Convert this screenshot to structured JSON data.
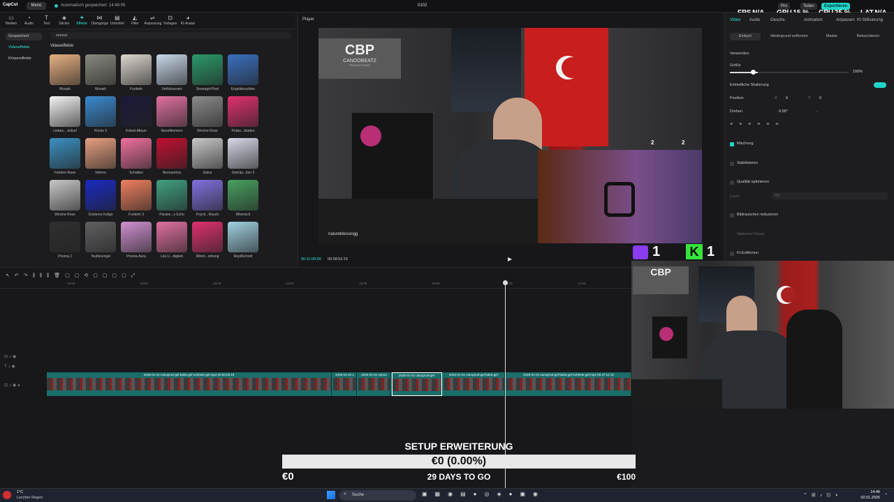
{
  "app": {
    "name": "CapCut",
    "menu": "Menü",
    "autosave": "Automatisch gespeichert: 14:46:05",
    "project": "0102"
  },
  "stats": {
    "fps_label": "FPS",
    "fps": "N/A",
    "gpu_label": "GPU",
    "gpu": "15 %",
    "cpu_label": "CPU",
    "cpu": "25 %",
    "lat_label": "LAT",
    "lat": "N/A"
  },
  "header_buttons": {
    "pro": "Pro",
    "share": "Teilen",
    "export": "Exportieren"
  },
  "toolbar": [
    "Medien",
    "Audio",
    "Text",
    "Sticker",
    "Effekte",
    "Übergänge",
    "Untertitel",
    "Filter",
    "Anpassung",
    "Vorlagen",
    "KI-Avatar"
  ],
  "categories": [
    "Gespeichert",
    "Videoeffekte",
    "Körpereffekte"
  ],
  "search_value": "zensur",
  "section_title": "Videoeffekte",
  "effects": [
    "Mosaik",
    "Mosaik",
    "Funkeln",
    "Umfokussiert",
    "Smaragd-Pixel",
    "Engelsleuchten",
    "Liebes-...kritzel",
    "Kricke 3",
    "Kritzel-Album",
    "Neonflimmern",
    "Weiche Rose",
    "Pulsie...tbatten",
    "Farbton-Rave",
    "Inferno",
    "Schatten",
    "Neonumriss",
    "Glanz",
    "Gekräu...lien 3",
    "Weiche Rose",
    "Düsteres Indigo",
    "Funkeln 3",
    "Parano...s Echo",
    "Psych...Rauch",
    "Ätherisch",
    "Prisma 2",
    "Teufelsengel",
    "Prisma-Aura",
    "Lila Li...digkeit",
    "Ätheri...rehung",
    "RepliSchnitt"
  ],
  "player": {
    "label": "Player",
    "time_current": "00:11:00:00",
    "time_total": "00:58:52:15"
  },
  "video": {
    "logo_main": "CBP",
    "logo_sub": "CANOOBEATZ",
    "logo_sub2": "PRODUCTIONS",
    "overlay_left": "natureblessingg",
    "score_a": "2",
    "score_b": "2"
  },
  "score": {
    "twitch": "1",
    "kick": "1"
  },
  "inspector": {
    "tabs": [
      "Video",
      "Audio",
      "Gesche.",
      "Animation",
      "Anpassen",
      "KI-Stilisierung"
    ],
    "subtabs": [
      "Einfach",
      "Hintergrund entfernen",
      "Maske",
      "Retuschieren"
    ],
    "verwenden": "Verwenden",
    "groesse": "Größe",
    "groesse_val": "100%",
    "skalierung": "Einheitliche Skalierung",
    "position": "Position",
    "pos_x_label": "X",
    "pos_x": "0",
    "pos_y_label": "Y",
    "pos_y": "0",
    "drehen": "Drehen",
    "drehen_val": "0.00°",
    "drehen_dash": "-",
    "mischung": "Mischung",
    "stabil": "Stabilisieren",
    "qualitaet": "Qualität optimieren",
    "qualitaet_mode": "HD",
    "qualitaet_level": "Level",
    "rauschen": "Bildrauschen reduzieren",
    "rauschen_sub": "Optische Flüsse",
    "ki": "KI-Entfernen"
  },
  "timeline": {
    "ticks": [
      "10:04",
      "10:05",
      "10:03",
      "10:04",
      "10:05",
      "10:06",
      "11:00",
      "11:02"
    ],
    "clips": [
      "2026-01-01-canoprod-gel-baba-gel-sohbete-gel.mp4  00:00:05:18",
      "2026-01-01-c",
      "2026-01-01-canoo",
      "2026-01-01-canoprod-gel-",
      "2026-01-01-canoprod-gel-baba-gel-",
      "2026-01-01-canoprod-gel-baba-gel-sohbete-gel.mp4  00:47:12:15"
    ]
  },
  "donation": {
    "title": "SETUP ERWEITERUNG",
    "amount": "€0 (0.00%)",
    "min": "€0",
    "days": "29 DAYS TO GO",
    "max": "€100",
    "progress": 0
  },
  "weather": {
    "temp": "1°C",
    "cond": "Leichter Regen"
  },
  "taskbar": {
    "search": "Suche",
    "time": "14:46",
    "date": "02.01.2026"
  }
}
